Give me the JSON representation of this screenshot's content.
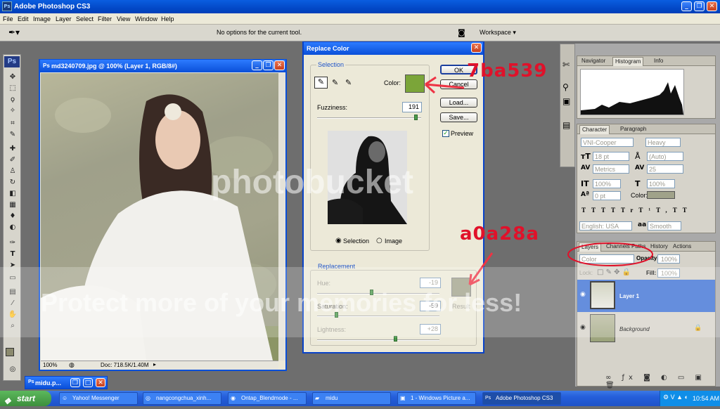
{
  "app": {
    "title": "Adobe Photoshop CS3",
    "icon_text": "Ps"
  },
  "menu": [
    "File",
    "Edit",
    "Image",
    "Layer",
    "Select",
    "Filter",
    "View",
    "Window",
    "Help"
  ],
  "options_bar": {
    "message": "No options for the current tool.",
    "workspace_label": "Workspace ▾"
  },
  "toolbox": {
    "logo": "Ps"
  },
  "document": {
    "title": "md3240709.jpg @ 100% (Layer 1, RGB/8#)",
    "zoom": "100%",
    "doc_info": "Doc: 718.5K/1.40M"
  },
  "minimized_doc": {
    "title": "midu.p..."
  },
  "dialog": {
    "title": "Replace Color",
    "selection_group": "Selection",
    "color_label": "Color:",
    "color_swatch": "#7ba539",
    "fuzziness_label": "Fuzziness:",
    "fuzziness_value": "191",
    "fuzziness_fraction": 0.95,
    "buttons": {
      "ok": "OK",
      "cancel": "Cancel",
      "load": "Load...",
      "save": "Save..."
    },
    "preview_label": "Preview",
    "radio_selection": "Selection",
    "radio_image": "Image",
    "replacement_group": "Replacement",
    "hue_label": "Hue:",
    "hue_value": "-19",
    "saturation_label": "Saturation:",
    "saturation_value": "-59",
    "lightness_label": "Lightness:",
    "lightness_value": "+28",
    "result_label": "Result",
    "result_swatch": "#a0a28a"
  },
  "annotations": {
    "color1": "7ba539",
    "color2": "a0a28a"
  },
  "watermark": {
    "line1": "photobucket",
    "line2": "Protect more of your memories for less!"
  },
  "navigator_panel": {
    "tabs": [
      "Navigator",
      "Histogram",
      "Info"
    ]
  },
  "character_panel": {
    "tabs": [
      "Character",
      "Paragraph"
    ],
    "font_family": "VNI-Cooper",
    "font_style": "Heavy",
    "font_size": "18 pt",
    "leading": "(Auto)",
    "kerning": "Metrics",
    "tracking": "25",
    "vscale": "100%",
    "hscale": "100%",
    "baseline": "0 pt",
    "color_label": "Color:",
    "language": "English: USA",
    "antialias_icon": "aa",
    "antialias": "Smooth",
    "type_buttons": [
      "T",
      "T",
      "TT",
      "Tr",
      "T¹",
      "T,",
      "T",
      "T"
    ]
  },
  "layers_panel": {
    "tabs": [
      "Layers",
      "Channels",
      "Paths",
      "History",
      "Actions"
    ],
    "blend_mode": "Color",
    "opacity_label": "Opacity:",
    "opacity_value": "100%",
    "lock_label": "Lock:",
    "fill_label": "Fill:",
    "fill_value": "100%",
    "layers": [
      {
        "name": "Layer 1",
        "selected": true
      },
      {
        "name": "Background",
        "selected": false
      }
    ]
  },
  "taskbar": {
    "start": "start",
    "items": [
      "Yahoo! Messenger",
      "nangcongchua_xinh...",
      "Ontap_Blendmode - ...",
      "midu",
      "1 - Windows Picture a...",
      "Adobe Photoshop CS3"
    ],
    "time": "10:54 AM"
  }
}
